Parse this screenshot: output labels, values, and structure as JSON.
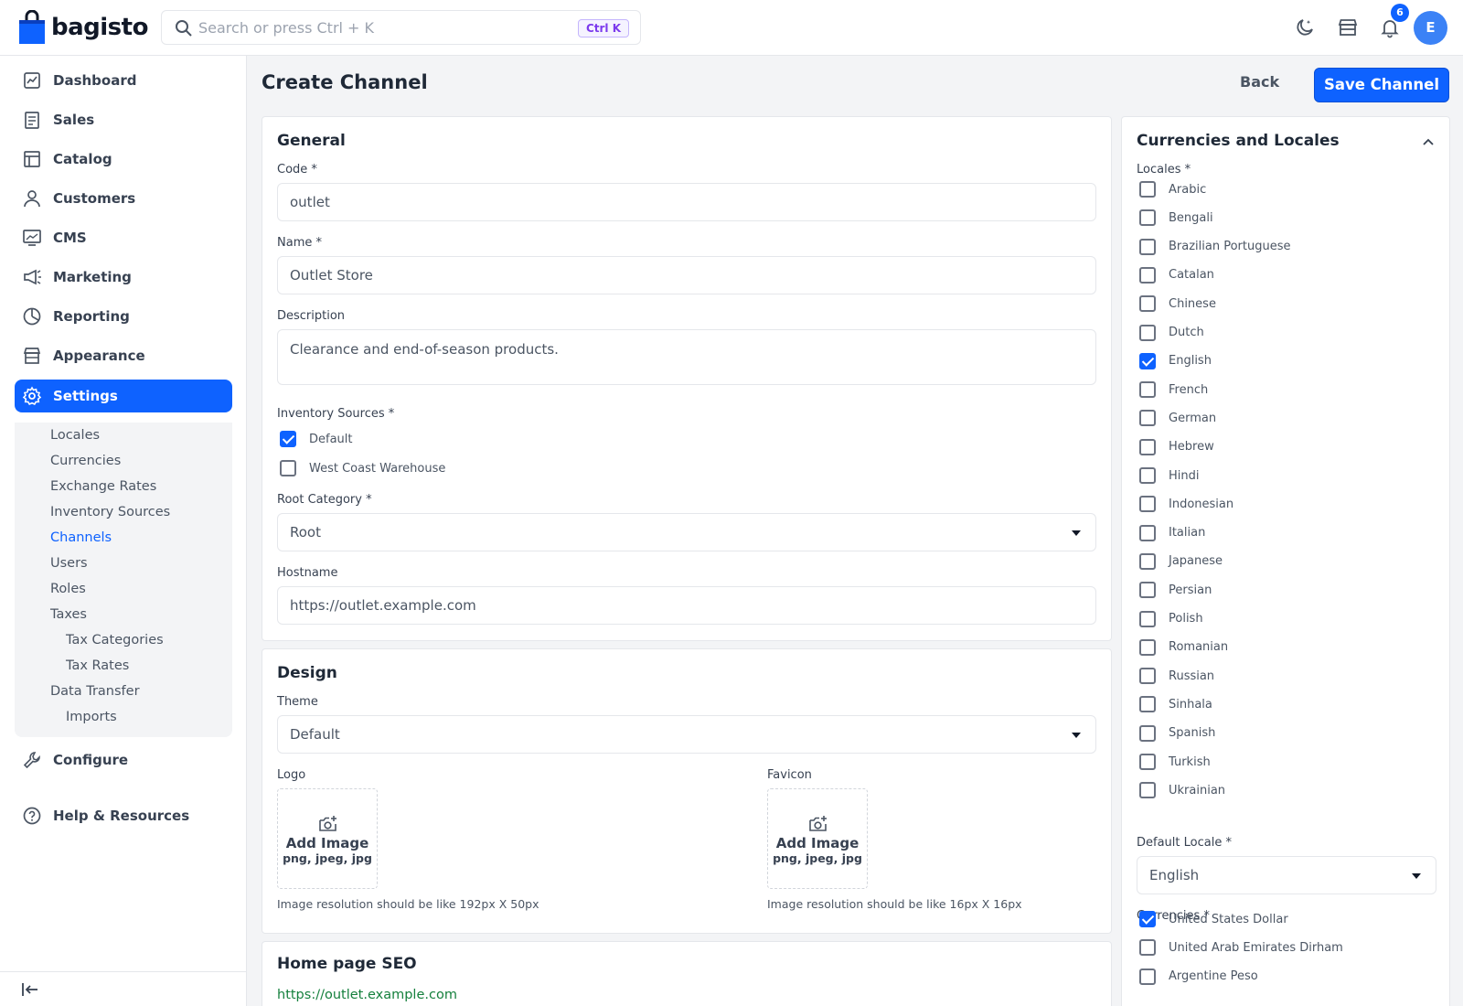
{
  "header": {
    "brand": "bagisto",
    "search_placeholder": "Search or press Ctrl + K",
    "search_shortcut": "Ctrl K",
    "notification_count": "6",
    "avatar_initial": "E"
  },
  "sidebar": {
    "items": [
      {
        "label": "Dashboard",
        "icon": "dashboard-icon"
      },
      {
        "label": "Sales",
        "icon": "sales-icon"
      },
      {
        "label": "Catalog",
        "icon": "catalog-icon"
      },
      {
        "label": "Customers",
        "icon": "customers-icon"
      },
      {
        "label": "CMS",
        "icon": "cms-icon"
      },
      {
        "label": "Marketing",
        "icon": "marketing-icon"
      },
      {
        "label": "Reporting",
        "icon": "reporting-icon"
      },
      {
        "label": "Appearance",
        "icon": "appearance-icon"
      },
      {
        "label": "Settings",
        "icon": "settings-icon",
        "active": true
      }
    ],
    "settings_sub": [
      "Locales",
      "Currencies",
      "Exchange Rates",
      "Inventory Sources",
      "Channels",
      "Users",
      "Roles",
      "Taxes",
      "Tax Categories",
      "Tax Rates",
      "Data Transfer",
      "Imports"
    ],
    "active_sub": "Channels",
    "configure": "Configure",
    "help": "Help & Resources"
  },
  "page": {
    "title": "Create Channel",
    "back": "Back",
    "save": "Save Channel"
  },
  "general": {
    "title": "General",
    "code_label": "Code *",
    "code_value": "outlet",
    "name_label": "Name *",
    "name_value": "Outlet Store",
    "desc_label": "Description",
    "desc_value": "Clearance and end-of-season products.",
    "inv_label": "Inventory Sources *",
    "inv_sources": [
      {
        "label": "Default",
        "checked": true
      },
      {
        "label": "West Coast Warehouse",
        "checked": false
      }
    ],
    "root_label": "Root Category *",
    "root_value": "Root",
    "host_label": "Hostname",
    "host_value": "https://outlet.example.com"
  },
  "design": {
    "title": "Design",
    "theme_label": "Theme",
    "theme_value": "Default",
    "logo_label": "Logo",
    "favicon_label": "Favicon",
    "add_image": "Add Image",
    "formats": "png, jpeg, jpg",
    "logo_hint": "Image resolution should be like 192px X 50px",
    "favicon_hint": "Image resolution should be like 16px X 16px"
  },
  "seo": {
    "title": "Home page SEO",
    "url": "https://outlet.example.com"
  },
  "locales_panel": {
    "title": "Currencies and Locales",
    "locales_label": "Locales *",
    "locales": [
      {
        "label": "Arabic",
        "checked": false
      },
      {
        "label": "Bengali",
        "checked": false
      },
      {
        "label": "Brazilian Portuguese",
        "checked": false
      },
      {
        "label": "Catalan",
        "checked": false
      },
      {
        "label": "Chinese",
        "checked": false
      },
      {
        "label": "Dutch",
        "checked": false
      },
      {
        "label": "English",
        "checked": true
      },
      {
        "label": "French",
        "checked": false
      },
      {
        "label": "German",
        "checked": false
      },
      {
        "label": "Hebrew",
        "checked": false
      },
      {
        "label": "Hindi",
        "checked": false
      },
      {
        "label": "Indonesian",
        "checked": false
      },
      {
        "label": "Italian",
        "checked": false
      },
      {
        "label": "Japanese",
        "checked": false
      },
      {
        "label": "Persian",
        "checked": false
      },
      {
        "label": "Polish",
        "checked": false
      },
      {
        "label": "Romanian",
        "checked": false
      },
      {
        "label": "Russian",
        "checked": false
      },
      {
        "label": "Sinhala",
        "checked": false
      },
      {
        "label": "Spanish",
        "checked": false
      },
      {
        "label": "Turkish",
        "checked": false
      },
      {
        "label": "Ukrainian",
        "checked": false
      }
    ],
    "default_locale_label": "Default Locale *",
    "default_locale_value": "English",
    "currencies_label": "Currencies *",
    "currencies": [
      {
        "label": "United States Dollar",
        "checked": true
      },
      {
        "label": "United Arab Emirates Dirham",
        "checked": false
      },
      {
        "label": "Argentine Peso",
        "checked": false
      }
    ]
  },
  "colors": {
    "accent": "#0e62ff",
    "link_green": "#15803d"
  }
}
